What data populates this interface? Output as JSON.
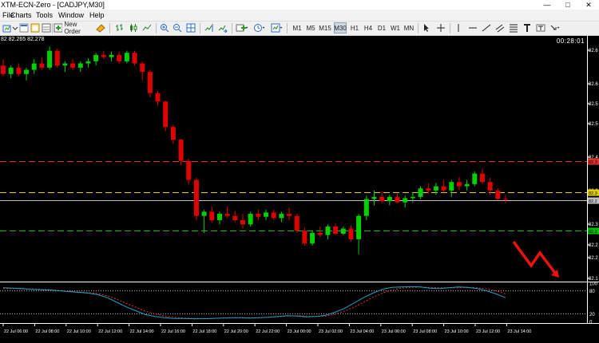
{
  "window": {
    "title": "XTM-ECN-Zero - [CADJPY,M30]",
    "min_glyph": "—",
    "max_glyph": "□",
    "close_glyph": "✕"
  },
  "menu": [
    "File",
    "Charts",
    "Tools",
    "Window",
    "Help"
  ],
  "toolbar": {
    "new_order": "New Order",
    "timeframes": [
      "M1",
      "M5",
      "M15",
      "M30",
      "H1",
      "H4",
      "D1",
      "W1",
      "MN"
    ],
    "icons": [
      "new-chart-icon",
      "profiles-icon",
      "market-watch-icon",
      "navigator-icon",
      "terminal-icon",
      "strategy-tester-icon",
      "new-order-icon",
      "autotrading-icon",
      "bar-chart-icon",
      "candlestick-icon",
      "line-chart-icon",
      "zoom-in-icon",
      "zoom-out-icon",
      "tile-windows-icon",
      "chart-shift-icon",
      "autoscroll-icon",
      "period-separators-icon",
      "indicators-icon",
      "periodicity-icon",
      "templates-icon",
      "cursor-icon",
      "crosshair-icon",
      "vertical-line-icon",
      "horizontal-line-icon",
      "trendline-icon",
      "equidistant-channel-icon",
      "fibonacci-icon",
      "text-icon",
      "text-label-icon",
      "arrow-icon"
    ]
  },
  "chart": {
    "symbol": "CADJPY",
    "timeframe": "M30",
    "ohlc_text": "82 82.265 82.278",
    "timer": "00:28:01",
    "colors": {
      "bull": "#00d000",
      "bear": "#e00000",
      "background": "#000000",
      "grid_text": "#ffffff",
      "stoch_main": "#20a0c8",
      "stoch_signal": "#e03030"
    },
    "price_labels": [
      "82.6",
      "82.6",
      "82.5",
      "82.5",
      "82.4",
      "82.3",
      "82.3",
      "82.2",
      "82.2",
      "82.1",
      "82.1"
    ],
    "time_labels": [
      "22 Jul 06:00",
      "22 Jul 08:00",
      "22 Jul 10:00",
      "22 Jul 12:00",
      "22 Jul 14:00",
      "22 Jul 16:00",
      "22 Jul 18:00",
      "22 Jul 20:00",
      "22 Jul 22:00",
      "23 Jul 00:00",
      "23 Jul 02:00",
      "23 Jul 04:00",
      "23 Jul 06:00",
      "23 Jul 08:00",
      "23 Jul 10:00",
      "23 Jul 12:00",
      "23 Jul 14:00"
    ],
    "horizontal_lines": [
      {
        "name": "resistance",
        "price": 82.37,
        "color": "#e03030",
        "tag": "82.3"
      },
      {
        "name": "yellow-level",
        "price": 82.295,
        "color": "#e0d000",
        "tag": "82.3"
      },
      {
        "name": "bid-line",
        "price": 82.278,
        "color": "#c0c0c0",
        "tag": "82.2"
      },
      {
        "name": "support",
        "price": 82.205,
        "color": "#00c000",
        "tag": "82.2"
      }
    ],
    "candles": [
      [
        82.595,
        82.61,
        82.57,
        82.575
      ],
      [
        82.575,
        82.595,
        82.565,
        82.59
      ],
      [
        82.59,
        82.6,
        82.57,
        82.575
      ],
      [
        82.575,
        82.59,
        82.56,
        82.585
      ],
      [
        82.585,
        82.61,
        82.575,
        82.6
      ],
      [
        82.6,
        82.615,
        82.585,
        82.59
      ],
      [
        82.59,
        82.64,
        82.585,
        82.63
      ],
      [
        82.63,
        82.635,
        82.59,
        82.595
      ],
      [
        82.595,
        82.605,
        82.58,
        82.6
      ],
      [
        82.6,
        82.61,
        82.585,
        82.59
      ],
      [
        82.59,
        82.605,
        82.58,
        82.6
      ],
      [
        82.6,
        82.612,
        82.59,
        82.605
      ],
      [
        82.605,
        82.625,
        82.595,
        82.62
      ],
      [
        82.62,
        82.63,
        82.61,
        82.615
      ],
      [
        82.615,
        82.628,
        82.605,
        82.62
      ],
      [
        82.62,
        82.628,
        82.6,
        82.605
      ],
      [
        82.605,
        82.63,
        82.6,
        82.625
      ],
      [
        82.625,
        82.63,
        82.595,
        82.6
      ],
      [
        82.6,
        82.605,
        82.56,
        82.58
      ],
      [
        82.58,
        82.585,
        82.52,
        82.53
      ],
      [
        82.53,
        82.535,
        82.5,
        82.51
      ],
      [
        82.51,
        82.512,
        82.44,
        82.45
      ],
      [
        82.45,
        82.455,
        82.41,
        82.42
      ],
      [
        82.42,
        82.422,
        82.36,
        82.37
      ],
      [
        82.37,
        82.375,
        82.315,
        82.325
      ],
      [
        82.325,
        82.33,
        82.23,
        82.24
      ],
      [
        82.24,
        82.255,
        82.2,
        82.25
      ],
      [
        82.25,
        82.262,
        82.225,
        82.23
      ],
      [
        82.23,
        82.25,
        82.22,
        82.245
      ],
      [
        82.245,
        82.262,
        82.235,
        82.24
      ],
      [
        82.24,
        82.252,
        82.225,
        82.23
      ],
      [
        82.23,
        82.245,
        82.21,
        82.22
      ],
      [
        82.22,
        82.25,
        82.215,
        82.245
      ],
      [
        82.245,
        82.255,
        82.23,
        82.238
      ],
      [
        82.238,
        82.255,
        82.23,
        82.248
      ],
      [
        82.248,
        82.255,
        82.23,
        82.235
      ],
      [
        82.235,
        82.25,
        82.225,
        82.245
      ],
      [
        82.245,
        82.26,
        82.23,
        82.24
      ],
      [
        82.24,
        82.245,
        82.2,
        82.205
      ],
      [
        82.205,
        82.212,
        82.17,
        82.175
      ],
      [
        82.175,
        82.205,
        82.17,
        82.2
      ],
      [
        82.2,
        82.215,
        82.19,
        82.195
      ],
      [
        82.195,
        82.22,
        82.185,
        82.215
      ],
      [
        82.215,
        82.222,
        82.195,
        82.198
      ],
      [
        82.198,
        82.215,
        82.195,
        82.21
      ],
      [
        82.21,
        82.218,
        82.18,
        82.185
      ],
      [
        82.185,
        82.245,
        82.15,
        82.24
      ],
      [
        82.24,
        82.288,
        82.23,
        82.28
      ],
      [
        82.28,
        82.3,
        82.265,
        82.285
      ],
      [
        82.285,
        82.298,
        82.27,
        82.275
      ],
      [
        82.275,
        82.29,
        82.265,
        82.285
      ],
      [
        82.285,
        82.292,
        82.27,
        82.272
      ],
      [
        82.272,
        82.288,
        82.26,
        82.282
      ],
      [
        82.282,
        82.295,
        82.272,
        82.285
      ],
      [
        82.285,
        82.31,
        82.28,
        82.305
      ],
      [
        82.305,
        82.318,
        82.292,
        82.3
      ],
      [
        82.3,
        82.318,
        82.29,
        82.31
      ],
      [
        82.31,
        82.325,
        82.295,
        82.3
      ],
      [
        82.3,
        82.325,
        82.285,
        82.32
      ],
      [
        82.32,
        82.332,
        82.3,
        82.31
      ],
      [
        82.31,
        82.325,
        82.3,
        82.315
      ],
      [
        82.315,
        82.345,
        82.31,
        82.34
      ],
      [
        82.34,
        82.352,
        82.315,
        82.32
      ],
      [
        82.32,
        82.33,
        82.29,
        82.3
      ],
      [
        82.3,
        82.305,
        82.278,
        82.28
      ],
      [
        82.28,
        82.29,
        82.27,
        82.278
      ]
    ],
    "stochastic": {
      "levels": [
        20,
        80
      ],
      "axis_labels": [
        "100",
        "80",
        "20",
        "0"
      ],
      "main": [
        88,
        87,
        86,
        84,
        83,
        82,
        80,
        78,
        76,
        74,
        70,
        62,
        50,
        38,
        28,
        18,
        13,
        10,
        8,
        8,
        7,
        7,
        8,
        9,
        10,
        10,
        9,
        10,
        11,
        13,
        15,
        14,
        12,
        13,
        16,
        24,
        34,
        48,
        62,
        74,
        84,
        89,
        90,
        91,
        90,
        87,
        86,
        88,
        90,
        89,
        86,
        80,
        72,
        62
      ],
      "signal": [
        86,
        86,
        85,
        85,
        84,
        83,
        81,
        79,
        77,
        75,
        73,
        67,
        58,
        47,
        37,
        27,
        20,
        14,
        11,
        9,
        8,
        8,
        8,
        9,
        9,
        10,
        10,
        10,
        11,
        12,
        14,
        15,
        14,
        13,
        14,
        19,
        27,
        37,
        50,
        63,
        74,
        82,
        87,
        89,
        90,
        89,
        88,
        88,
        88,
        89,
        88,
        85,
        80,
        72
      ]
    }
  }
}
